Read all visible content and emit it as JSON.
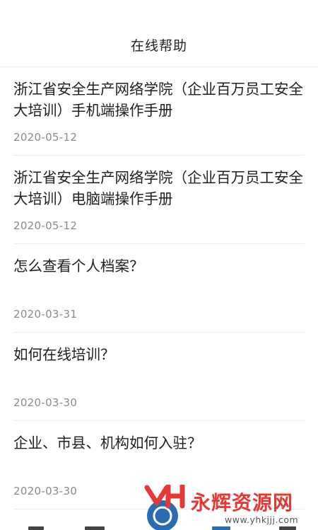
{
  "header": {
    "title": "在线帮助"
  },
  "articles": [
    {
      "title": "浙江省安全生产网络学院（企业百万员工安全大培训）手机端操作手册",
      "date": "2020-05-12"
    },
    {
      "title": "浙江省安全生产网络学院（企业百万员工安全大培训）电脑端操作手册",
      "date": "2020-05-12"
    },
    {
      "title": "怎么查看个人档案？",
      "date": "2020-03-31"
    },
    {
      "title": "如何在线培训？",
      "date": "2020-03-30"
    },
    {
      "title": "企业、市县、机构如何入驻？",
      "date": "2020-03-30"
    }
  ],
  "watermark": {
    "brand": "永辉资源网",
    "url": "www.yhkjjj.com",
    "colors": {
      "brand": "#e53935",
      "logo_blue": "#2b6cb0"
    }
  },
  "colors": {
    "background": "#ffffff",
    "divider": "#ececec",
    "title_text": "#1f1f1f",
    "date_text": "#8a8a8a"
  }
}
